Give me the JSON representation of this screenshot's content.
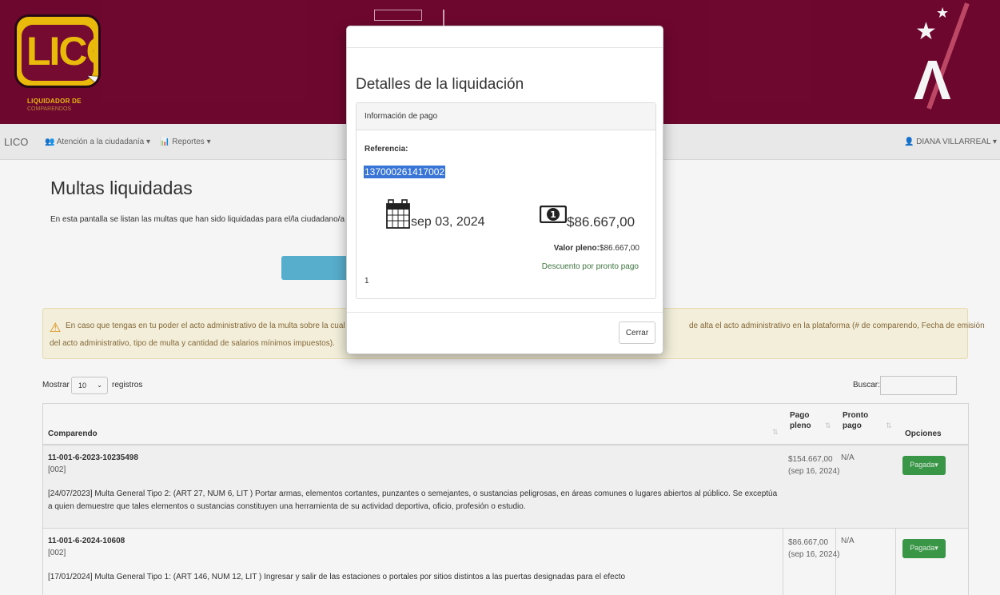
{
  "header": {
    "logo_text": "LICO",
    "logo_caption": "LIQUIDADOR DE",
    "logo_caption2": "COMPARENDOS",
    "colors": {
      "brand": "#730830",
      "accent": "#f3c10d"
    }
  },
  "navbar": {
    "brand": "LICO",
    "items": [
      {
        "icon": "users-icon",
        "label": "Atención a la ciudadanía"
      },
      {
        "icon": "chart-icon",
        "label": "Reportes"
      }
    ],
    "user": "DIANA VILLARREAL"
  },
  "page": {
    "title": "Multas liquidadas",
    "description": "En esta pantalla se listan las multas que han sido liquidadas para el/la ciudadano/a identificado/a"
  },
  "alert": {
    "text_line1_left": "En caso que tengas en tu poder el acto administrativo de la multa sobre la cual deseas",
    "text_line1_right": "de alta el acto administrativo en la plataforma (# de comparendo, Fecha de emisión",
    "text_line2": "del acto administrativo, tipo de multa y cantidad de salarios mínimos impuestos)."
  },
  "table_controls": {
    "show_label": "Mostrar",
    "show_value": "10",
    "records_label": "registros",
    "search_label": "Buscar:"
  },
  "table": {
    "headers": {
      "comparendo": "Comparendo",
      "pago_pleno_1": "Pago",
      "pago_pleno_2": "pleno",
      "pronto_pago_1": "Pronto",
      "pronto_pago_2": "pago",
      "opciones": "Opciones"
    },
    "rows": [
      {
        "title": "11-001-6-2023-10235498",
        "code": "[002]",
        "description": "[24/07/2023] Multa General Tipo 2: (ART 27, NUM 6, LIT ) Portar armas, elementos cortantes, punzantes o semejantes, o sustancias peligrosas, en áreas comunes o lugares abiertos al público. Se exceptúa a quien demuestre que tales elementos o sustancias constituyen una herramienta de su actividad deportiva, oficio, profesión o estudio.",
        "pago_pleno": "$154.667,00",
        "pago_fecha": "(sep 16, 2024)",
        "pronto_pago": "N/A",
        "action": "Pagada"
      },
      {
        "title": "11-001-6-2024-10608",
        "code": "[002]",
        "description": "[17/01/2024] Multa General Tipo 1: (ART 146, NUM 12, LIT ) Ingresar y salir de las estaciones o portales por sitios distintos a las puertas designadas para el efecto",
        "pago_pleno": "$86.667,00",
        "pago_fecha": "(sep 16, 2024)",
        "pronto_pago": "N/A",
        "action": "Pagada"
      }
    ]
  },
  "modal": {
    "title": "Detalles de la liquidación",
    "panel_heading": "Información de pago",
    "reference_label": "Referencia:",
    "reference_value": "137000261417002",
    "date": "sep 03, 2024",
    "amount": "$86.667,00",
    "valor_pleno_label": "Valor pleno:",
    "valor_pleno_value": "$86.667,00",
    "descuento": "Descuento por pronto pago",
    "index": "1",
    "close_label": "Cerrar"
  }
}
